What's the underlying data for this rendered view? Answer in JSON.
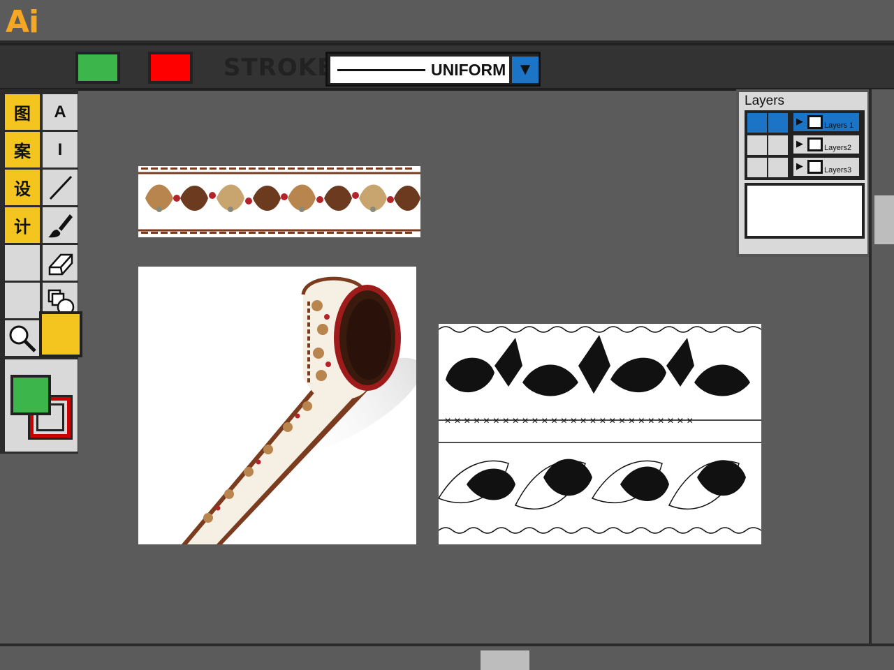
{
  "app": {
    "logo": "Ai"
  },
  "toolbar": {
    "fill_color": "#3cb54a",
    "stroke_color": "#ff0000",
    "stroke_label": "STROKE",
    "stroke_profile": "UNIFORM",
    "dropdown_icon": "triangle-down-icon"
  },
  "tools": {
    "yellow_labels": [
      "图",
      "案",
      "设",
      "计"
    ],
    "type_tool": "A",
    "vertical_type_tool": "I",
    "icons": [
      "line-icon",
      "brush-icon",
      "eraser-icon",
      "shape-builder-icon",
      "zoom-icon"
    ],
    "fill": "#3cb54a",
    "stroke": "#cc0000"
  },
  "layers": {
    "title": "Layers",
    "items": [
      {
        "name": "Layers 1",
        "selected": true
      },
      {
        "name": "Layers2",
        "selected": false
      },
      {
        "name": "Layers3",
        "selected": false
      }
    ]
  },
  "canvas": {
    "artworks": [
      "pattern-strip",
      "tape-roll-mockup",
      "black-white-pattern"
    ],
    "accent": "#7a3b1e"
  }
}
